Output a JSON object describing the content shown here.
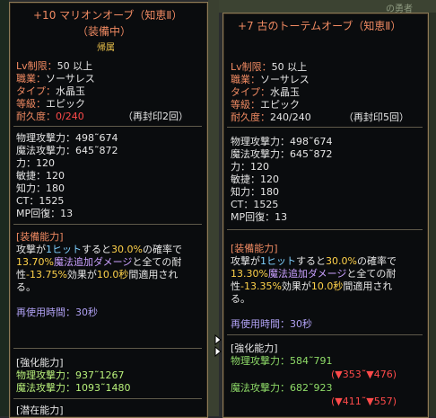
{
  "background": {
    "top_right_text": "の勇者"
  },
  "left": {
    "title_line1": "+10 マリオンオーブ（知恵Ⅱ）",
    "title_line2": "（装備中）",
    "bound": "帰属",
    "props": [
      {
        "label": "Lv制限：",
        "value": "50 以上"
      },
      {
        "label": "職業：",
        "value": "ソーサレス"
      },
      {
        "label": "タイプ：",
        "value": "水晶玉"
      },
      {
        "label": "等級：",
        "value": "エピック"
      }
    ],
    "durability": {
      "label": "耐久度：",
      "value": "0/240",
      "reseal": "（再封印2回）"
    },
    "stats": [
      "物理攻撃力：498˜674",
      "魔法攻撃力：645˜872",
      "力：120",
      "敏捷：120",
      "知力：180",
      "CT：1525",
      "MP回復：13"
    ],
    "ability_header": "[装備能力]",
    "ability": {
      "p1": "攻撃が",
      "p2": "1ヒット",
      "p3": "すると",
      "p4": "30.0%",
      "p5": "の確率で",
      "p6": "13.70%",
      "p7": "魔法追加ダメージ",
      "p8": "と",
      "p9": "全ての耐",
      "p10": "性",
      "p11": "-13.75%",
      "p12": "効果が",
      "p13": "10.0秒",
      "p14": "間適用され",
      "p15": "る。"
    },
    "reuse": "再使用時間：30秒",
    "enhance_header": "[強化能力]",
    "enhance": [
      "物理攻撃力：937˜1267",
      "魔法攻撃力：1093˜1480"
    ],
    "potential_header": "[潜在能力]"
  },
  "right": {
    "title": "+7 古のトーテムオーブ（知恵Ⅱ）",
    "props": [
      {
        "label": "Lv制限：",
        "value": "50 以上"
      },
      {
        "label": "職業：",
        "value": "ソーサレス"
      },
      {
        "label": "タイプ：",
        "value": "水晶玉"
      },
      {
        "label": "等級：",
        "value": "エピック"
      }
    ],
    "durability": {
      "label": "耐久度：",
      "value": "240/240",
      "reseal": "（再封印5回）"
    },
    "stats": [
      "物理攻撃力：498˜674",
      "魔法攻撃力：645˜872",
      "力：120",
      "敏捷：120",
      "知力：180",
      "CT：1525",
      "MP回復：13"
    ],
    "ability_header": "[装備能力]",
    "ability": {
      "p1": "攻撃が",
      "p2": "1ヒット",
      "p3": "すると",
      "p4": "30.0%",
      "p5": "の確率で",
      "p6": "13.30%",
      "p7": "魔法追加ダメージ",
      "p8": "と",
      "p9": "全ての耐",
      "p10": "性",
      "p11": "-13.35%",
      "p12": "効果が",
      "p13": "10.0秒",
      "p14": "間適用され",
      "p15": "る。"
    },
    "reuse": "再使用時間：30秒",
    "enhance_header": "[強化能力]",
    "enhance": [
      {
        "stat": "物理攻撃力：584˜791",
        "diff": "(▼353˜▼476)"
      },
      {
        "stat": "魔法攻撃力：682˜923",
        "diff": "(▼411˜▼557)"
      }
    ]
  }
}
